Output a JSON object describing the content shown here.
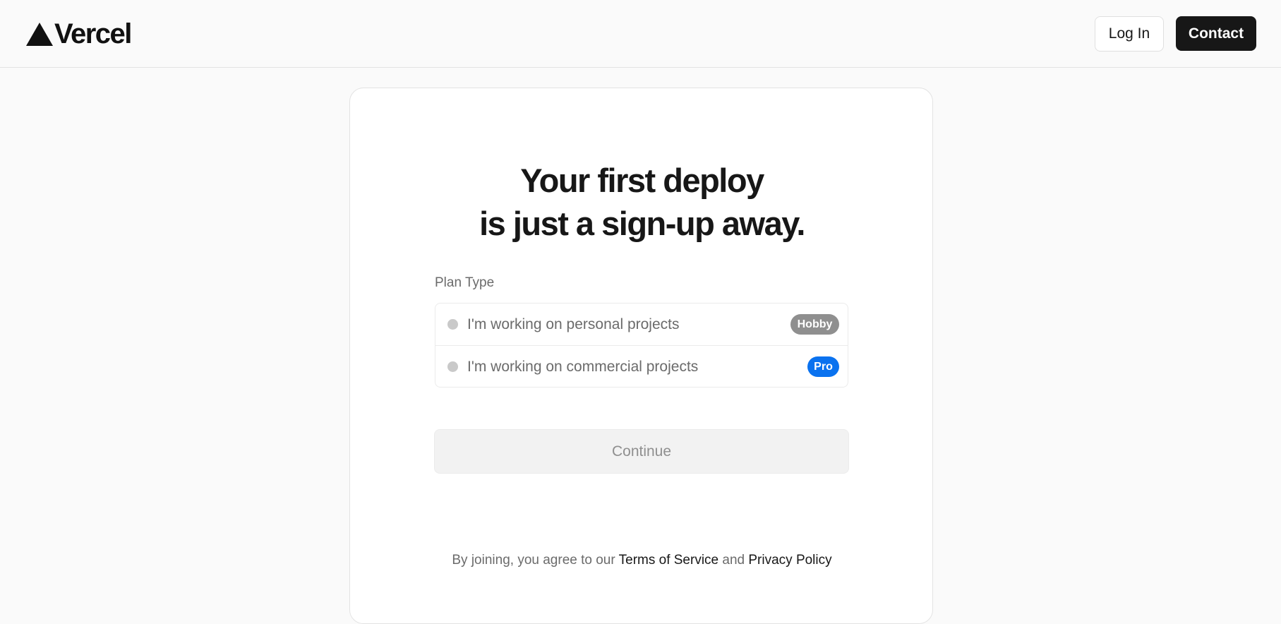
{
  "header": {
    "brand": "Vercel",
    "login_label": "Log In",
    "contact_label": "Contact"
  },
  "signup": {
    "headline_line1": "Your first deploy",
    "headline_line2": "is just a sign-up away.",
    "plan_type_label": "Plan Type",
    "options": [
      {
        "label": "I'm working on personal projects",
        "badge": "Hobby",
        "badge_color": "#8f8f8f"
      },
      {
        "label": "I'm working on commercial projects",
        "badge": "Pro",
        "badge_color": "#0a72ef"
      }
    ],
    "continue_label": "Continue",
    "continue_disabled": true,
    "terms_prefix": "By joining, you agree to our",
    "terms_link": "Terms of Service",
    "terms_and": "and",
    "privacy_link": "Privacy Policy"
  },
  "icons": {
    "logo": "vercel-triangle-icon",
    "radio": "radio-circle-icon"
  }
}
